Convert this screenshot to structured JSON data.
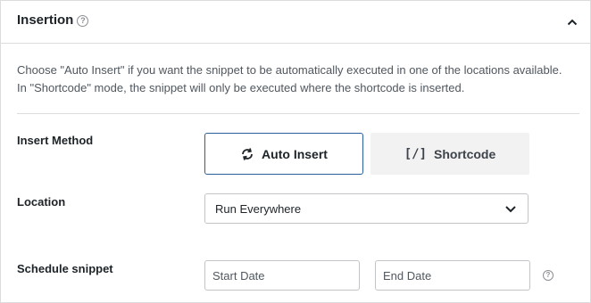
{
  "header": {
    "title": "Insertion",
    "help_icon": "question-circle-icon",
    "collapse_icon": "chevron-up-icon"
  },
  "description": "Choose \"Auto Insert\" if you want the snippet to be automatically executed in one of the locations available. In \"Shortcode\" mode, the snippet will only be executed where the shortcode is inserted.",
  "insert_method": {
    "label": "Insert Method",
    "options": [
      {
        "label": "Auto Insert",
        "icon": "sync-icon",
        "selected": true
      },
      {
        "label": "Shortcode",
        "icon_text": "[/]",
        "selected": false
      }
    ]
  },
  "location": {
    "label": "Location",
    "selected": "Run Everywhere"
  },
  "schedule": {
    "label": "Schedule snippet",
    "start_placeholder": "Start Date",
    "end_placeholder": "End Date"
  },
  "colors": {
    "accent_border": "#2c5e9c",
    "border": "#dcdcde",
    "muted_text": "#50575e"
  }
}
